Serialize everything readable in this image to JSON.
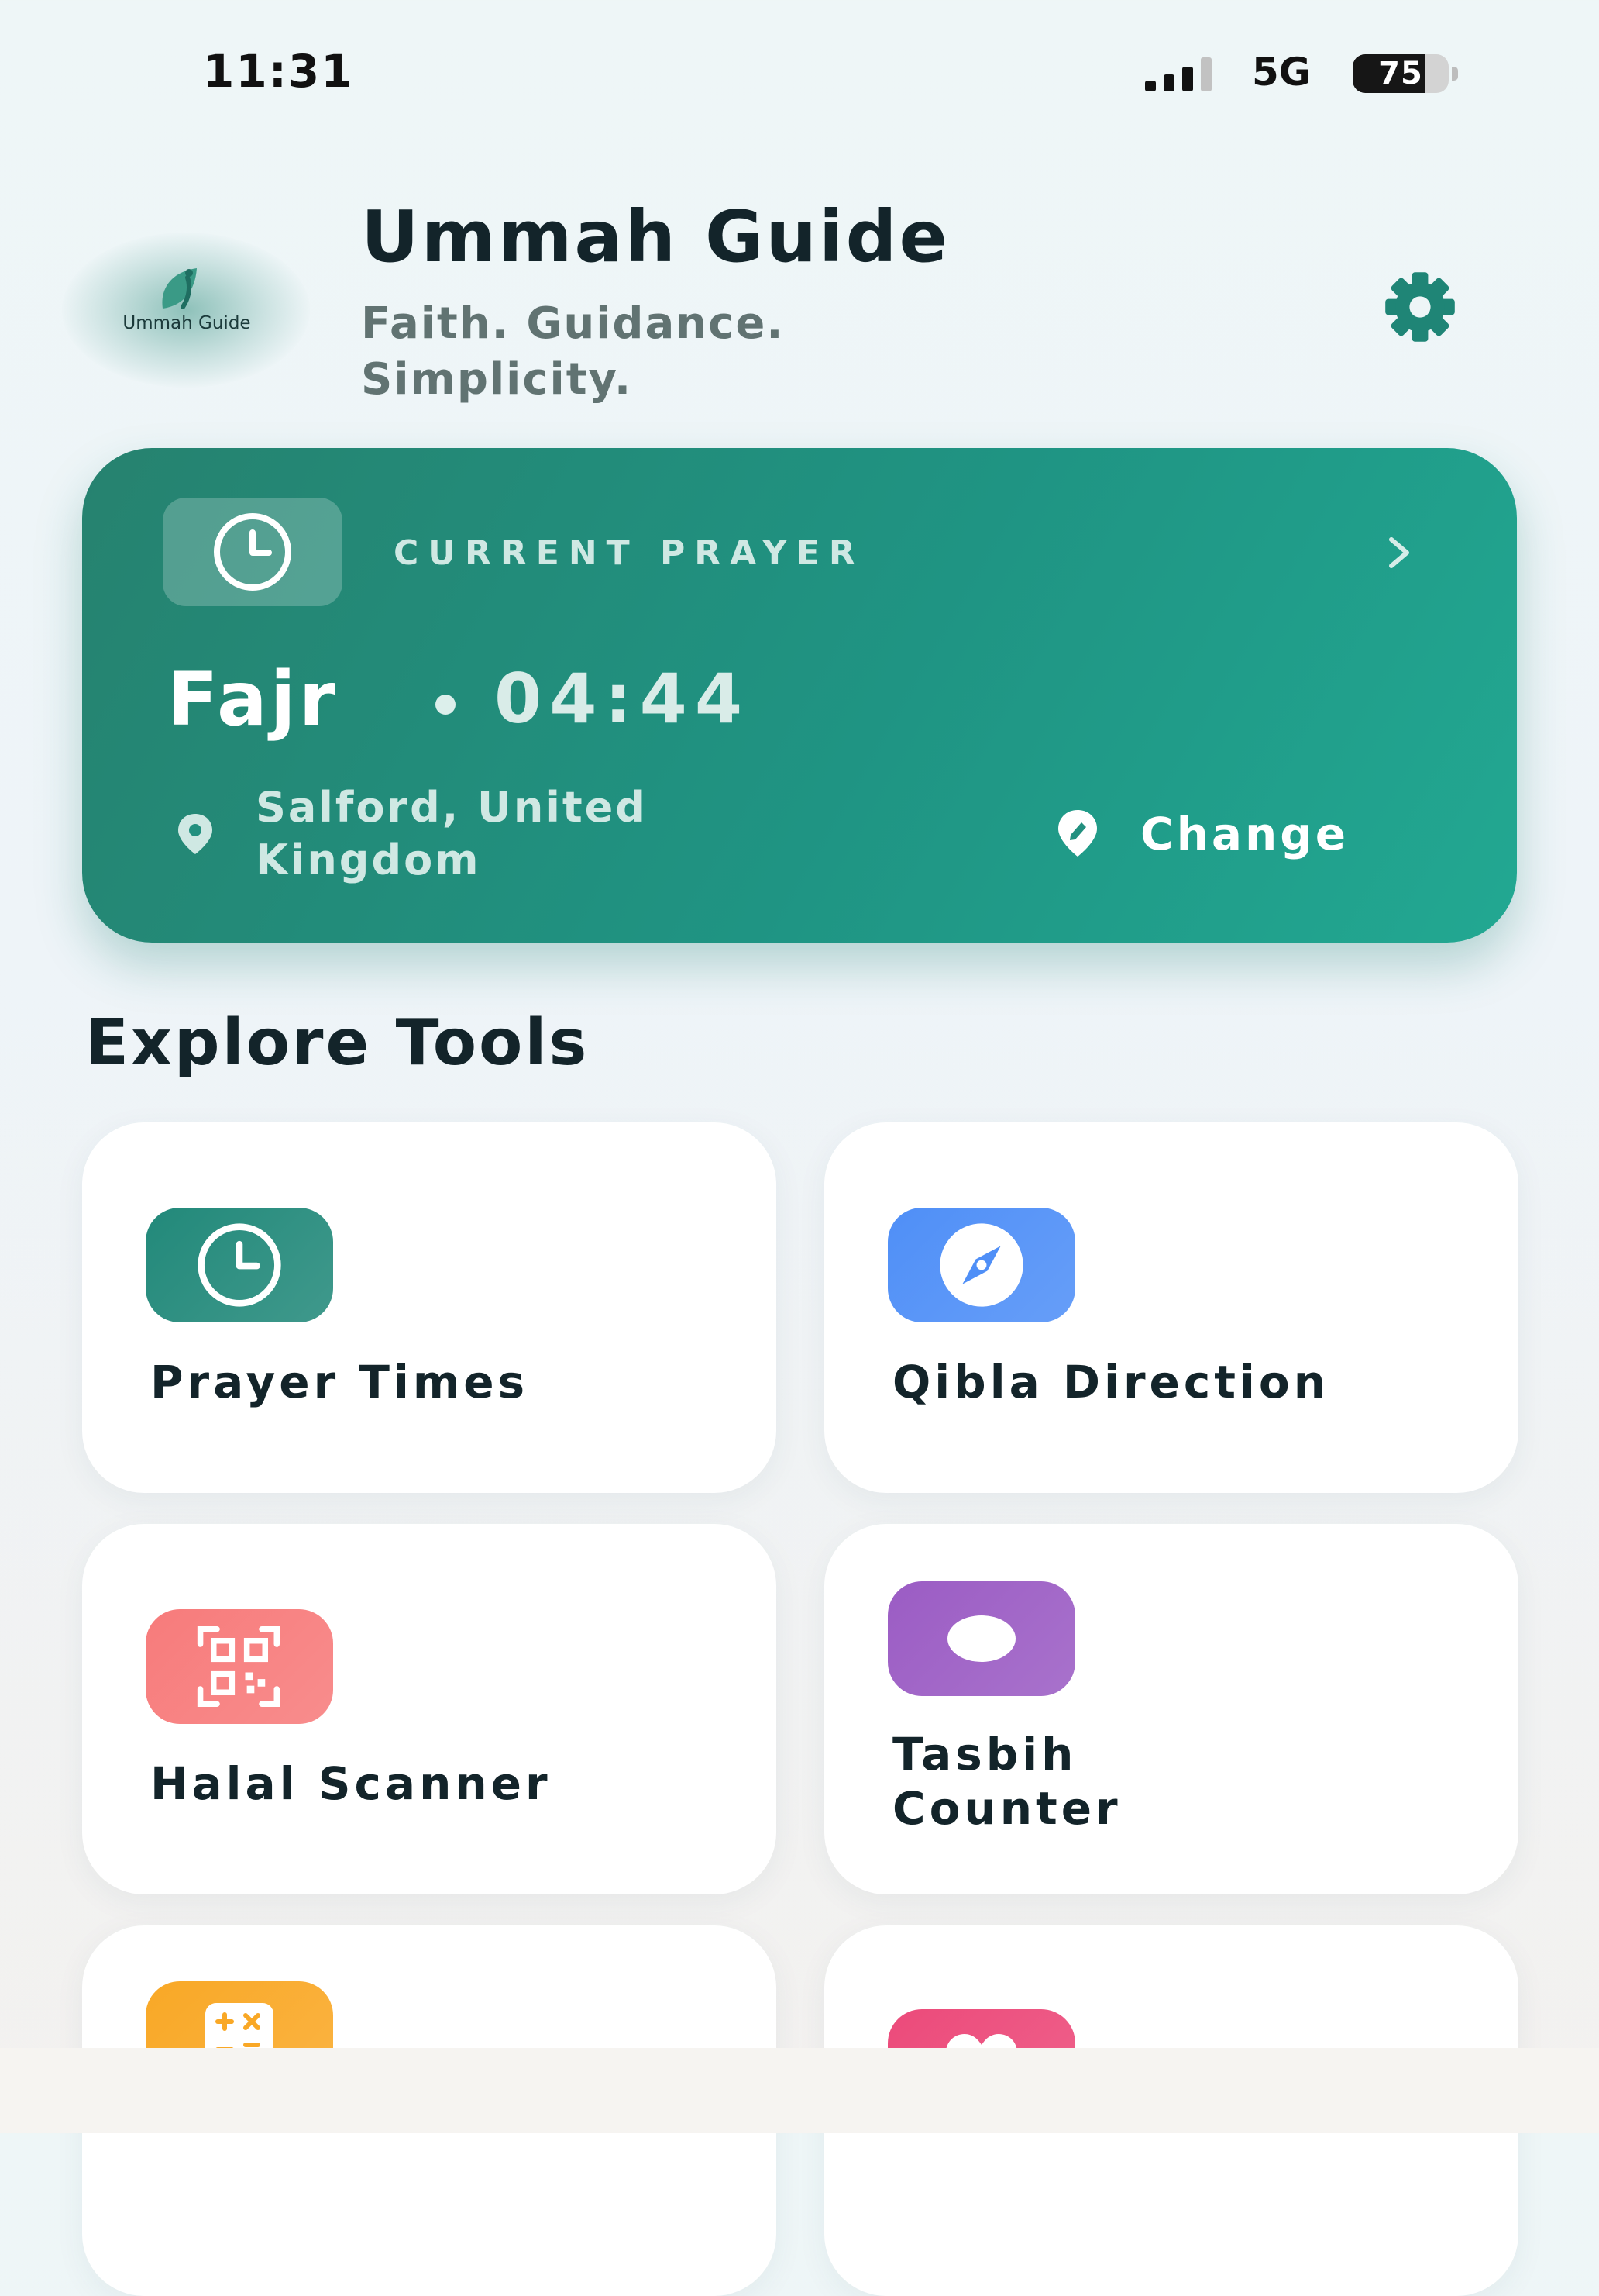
{
  "status_bar": {
    "time": "11:31",
    "network": "5G",
    "battery": "75",
    "battery_level": 0.75
  },
  "header": {
    "logo_text": "Ummah Guide",
    "title": "Ummah Guide",
    "subtitle": "Faith. Guidance. Simplicity.",
    "settings_icon": "gear-icon"
  },
  "prayer_card": {
    "heading": "CURRENT PRAYER",
    "prayer_name": "Fajr",
    "prayer_time": "04:44",
    "location": "Salford, United Kingdom",
    "change_label": "Change",
    "icons": [
      "clock-icon",
      "chevron-right-icon",
      "location-pin-icon",
      "edit-location-icon"
    ]
  },
  "section_title": "Explore Tools",
  "tools": [
    {
      "label": "Prayer Times",
      "icon": "clock-icon",
      "color": "#22897a"
    },
    {
      "label": "Qibla Direction",
      "icon": "compass-icon",
      "color": "#4f8ff7"
    },
    {
      "label": "Halal Scanner",
      "icon": "qr-scan-icon",
      "color": "#f77b7b"
    },
    {
      "label": "Tasbih Counter",
      "icon": "tasbih-icon",
      "color": "#9b5cc4"
    },
    {
      "label": "",
      "icon": "calculator-icon",
      "color": "#f9a826"
    },
    {
      "label": "",
      "icon": "heart-icon",
      "color": "#ec4a7a"
    }
  ],
  "colors": {
    "brand": "#1f9483",
    "card_background": "#ffffff",
    "title_text": "#13242a"
  }
}
